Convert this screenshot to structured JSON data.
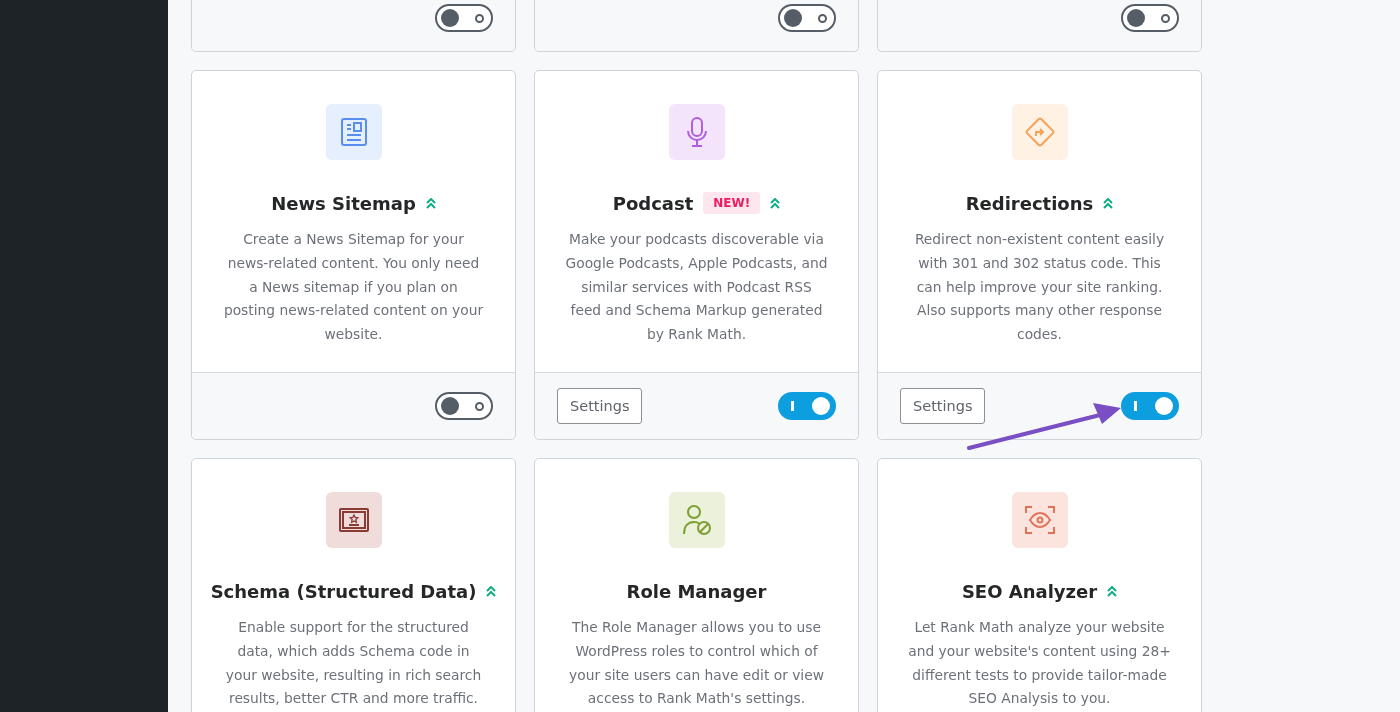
{
  "rows": [
    {
      "modules": [
        {
          "on": false
        },
        {
          "on": false
        },
        {
          "on": false
        }
      ]
    },
    {
      "modules": [
        {
          "kind": "news",
          "title": "News Sitemap",
          "pro": true,
          "description": "Create a News Sitemap for your news-related content. You only need a News sitemap if you plan on posting news-related content on your website.",
          "on": false
        },
        {
          "kind": "mic",
          "title": "Podcast",
          "badge": "NEW!",
          "pro": true,
          "description": "Make your podcasts discoverable via Google Podcasts, Apple Podcasts, and similar services with Podcast RSS feed and Schema Markup generated by Rank Math.",
          "settings": "Settings",
          "on": true
        },
        {
          "kind": "redirect",
          "title": "Redirections",
          "pro": true,
          "description": "Redirect non-existent content easily with 301 and 302 status code. This can help improve your site ranking. Also supports many other response codes.",
          "settings": "Settings",
          "on": true,
          "arrow": true
        }
      ]
    },
    {
      "modules": [
        {
          "kind": "schema",
          "title": "Schema (Structured Data)",
          "pro": true,
          "description": "Enable support for the structured data, which adds Schema code in your website, resulting in rich search results, better CTR and more traffic."
        },
        {
          "kind": "role",
          "title": "Role Manager",
          "pro": false,
          "description": "The Role Manager allows you to use WordPress roles to control which of your site users can have edit or view access to Rank Math's settings."
        },
        {
          "kind": "seo",
          "title": "SEO Analyzer",
          "pro": true,
          "description": "Let Rank Math analyze your website and your website's content using 28+ different tests to provide tailor-made SEO Analysis to you."
        }
      ]
    }
  ]
}
